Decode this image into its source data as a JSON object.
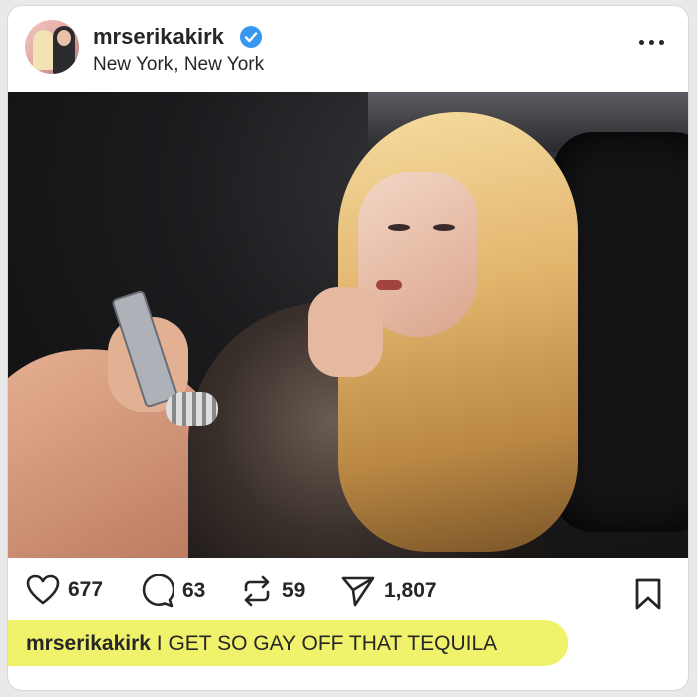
{
  "post": {
    "username": "mrserikakirk",
    "location": "New York, New York",
    "verified": true,
    "accent_color": "#3897f0",
    "caption_username": "mrserikakirk",
    "caption_text": " I GET SO GAY OFF THAT TEQUILA",
    "highlight_color": "#eff26a"
  },
  "actions": {
    "likes": "677",
    "comments": "63",
    "reposts": "59",
    "shares": "1,807"
  },
  "icons": {
    "like": "heart-icon",
    "comment": "comment-bubble-icon",
    "repost": "repost-icon",
    "share": "send-icon",
    "save": "bookmark-icon",
    "more": "more-options-icon"
  }
}
